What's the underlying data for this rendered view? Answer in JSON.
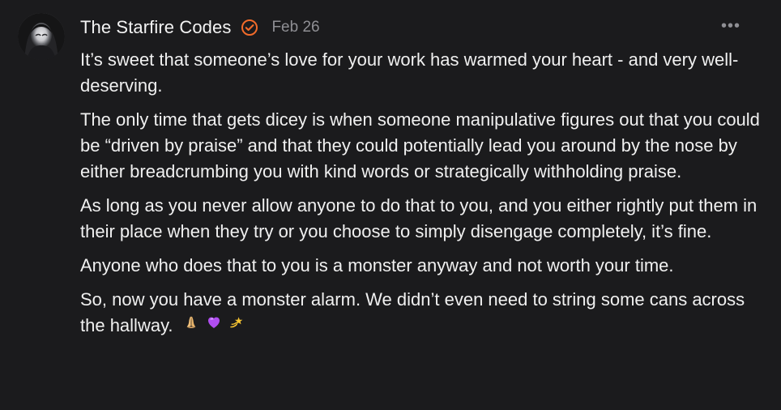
{
  "comment": {
    "author": "The Starfire Codes",
    "date": "Feb 26",
    "more_label": "•••",
    "icons": {
      "avatar": "avatar",
      "verified": "verified-check-icon",
      "more": "more-options-icon",
      "emoji": [
        "praying-hands-emoji",
        "purple-heart-emoji",
        "dizzy-star-emoji"
      ]
    },
    "colors": {
      "background": "#1b1b1d",
      "text": "#f0f0f0",
      "muted": "#8f8f94",
      "verified_orange": "#f26b2a",
      "purple": "#b04df0"
    },
    "paragraphs": [
      "It’s sweet that someone’s love for your work has warmed your heart - and very well-deserving.",
      "The only time that gets dicey is when someone manipulative figures out that you could be “driven by praise” and that they could potentially lead you around by the nose by either breadcrumbing you with kind words or strategically withholding praise.",
      "As long as you never allow anyone to do that to you, and you either rightly put them in their place when they try or you choose to simply disengage completely, it’s fine.",
      "Anyone who does that to you is a monster anyway and not worth your time.",
      "So, now you have a monster alarm. We didn’t even need to string some cans across the hallway."
    ]
  }
}
